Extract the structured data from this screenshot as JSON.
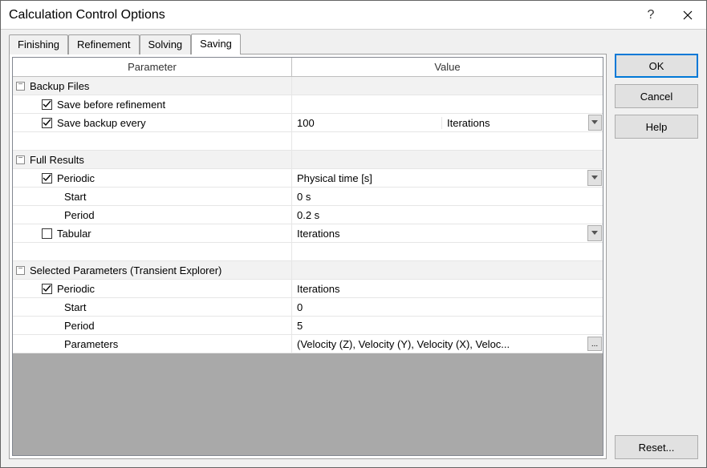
{
  "window": {
    "title": "Calculation Control Options"
  },
  "tabs": {
    "t0": "Finishing",
    "t1": "Refinement",
    "t2": "Solving",
    "t3": "Saving"
  },
  "headers": {
    "param": "Parameter",
    "value": "Value"
  },
  "groups": {
    "backup": "Backup Files",
    "full": "Full Results",
    "selected": "Selected Parameters (Transient Explorer)"
  },
  "rows": {
    "save_before_refinement": "Save before refinement",
    "save_backup_every": "Save backup every",
    "save_backup_num": "100",
    "save_backup_unit": "Iterations",
    "periodic": "Periodic",
    "periodic_full_value": "Physical time [s]",
    "start": "Start",
    "start_full": "0 s",
    "period": "Period",
    "period_full": "0.2 s",
    "tabular": "Tabular",
    "tabular_value": "Iterations",
    "periodic_sel_value": "Iterations",
    "start_sel": "0",
    "period_sel": "5",
    "parameters": "Parameters",
    "parameters_value": "(Velocity (Z), Velocity (Y), Velocity (X), Veloc..."
  },
  "buttons": {
    "ok": "OK",
    "cancel": "Cancel",
    "help": "Help",
    "reset": "Reset...",
    "ellipsis": "..."
  }
}
